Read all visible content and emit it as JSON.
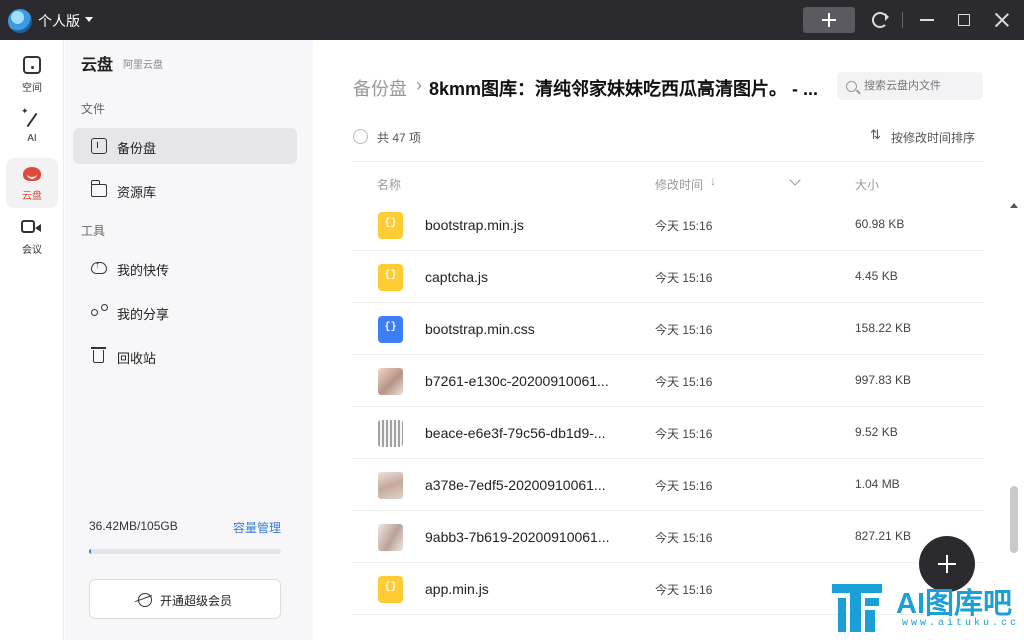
{
  "topbar": {
    "edition": "个人版"
  },
  "rail": [
    {
      "label": "空间",
      "icon": "space-icon",
      "active": false
    },
    {
      "label": "AI",
      "icon": "ai-wand-icon",
      "active": false
    },
    {
      "label": "云盘",
      "icon": "cloud-drive-icon",
      "active": true
    },
    {
      "label": "会议",
      "icon": "meeting-icon",
      "active": false
    }
  ],
  "sidebar": {
    "title": "云盘",
    "subtitle": "阿里云盘",
    "section_files": "文件",
    "section_tools": "工具",
    "items": [
      {
        "label": "备份盘",
        "icon": "backup-drive-icon",
        "active": true
      },
      {
        "label": "资源库",
        "icon": "folder-icon",
        "active": false
      },
      {
        "label": "我的快传",
        "icon": "cloud-upload-icon",
        "active": false
      },
      {
        "label": "我的分享",
        "icon": "share-icon",
        "active": false
      },
      {
        "label": "回收站",
        "icon": "trash-icon",
        "active": false
      }
    ],
    "storage": "36.42MB/105GB",
    "storage_used_fraction": 0.0003,
    "manage_label": "容量管理",
    "vip_label": "开通超级会员"
  },
  "main": {
    "breadcrumb_root": "备份盘",
    "breadcrumb_sep": "›",
    "breadcrumb_current": "8kmm图库：清纯邻家妹妹吃西瓜高清图片。 - ...",
    "search_placeholder": "搜索云盘内文件",
    "count": "共 47 项",
    "sort_label": "按修改时间排序",
    "columns": {
      "name": "名称",
      "modified": "修改时间",
      "size": "大小"
    },
    "rows": [
      {
        "name": "bootstrap.min.js",
        "date": "今天 15:16",
        "size": "60.98 KB",
        "type": "js"
      },
      {
        "name": "captcha.js",
        "date": "今天 15:16",
        "size": "4.45 KB",
        "type": "js"
      },
      {
        "name": "bootstrap.min.css",
        "date": "今天 15:16",
        "size": "158.22 KB",
        "type": "css"
      },
      {
        "name": "b7261-e130c-20200910061...",
        "date": "今天 15:16",
        "size": "997.83 KB",
        "type": "img"
      },
      {
        "name": "beace-e6e3f-79c56-db1d9-...",
        "date": "今天 15:16",
        "size": "9.52 KB",
        "type": "img"
      },
      {
        "name": "a378e-7edf5-20200910061...",
        "date": "今天 15:16",
        "size": "1.04 MB",
        "type": "img"
      },
      {
        "name": "9abb3-7b619-20200910061...",
        "date": "今天 15:16",
        "size": "827.21 KB",
        "type": "img"
      },
      {
        "name": "app.min.js",
        "date": "今天 15:16",
        "size": "",
        "type": "js"
      }
    ]
  },
  "watermark": {
    "text": "AI图库吧",
    "url": "www.aituku.cc"
  },
  "colors": {
    "accent": "#e04a3c",
    "link": "#3a7bd5",
    "js": "#ffcc33",
    "css": "#3d7ef5",
    "topbar": "#2b2b2f"
  }
}
